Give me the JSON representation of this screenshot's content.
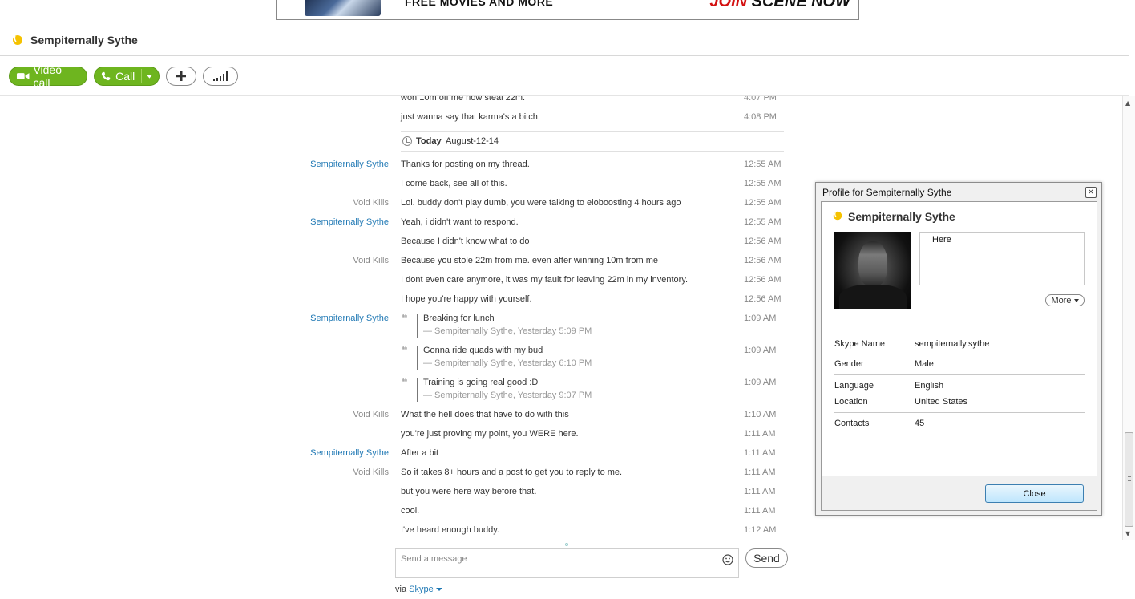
{
  "ad": {
    "left_text": "FREE MOVIES AND MORE",
    "right_join": "JOIN",
    "right_rest": " SCENE NOW"
  },
  "header": {
    "contact_name": "Sempiternally Sythe",
    "status_icon": "skype-status-away-icon",
    "status_color": "#f5c200"
  },
  "toolbar": {
    "video_call_label": "Video call",
    "call_label": "Call",
    "accent": "#6eb51f"
  },
  "chat": {
    "previous": [
      {
        "text": "won 10m off me now steal 22m.",
        "time": "4:07 PM"
      },
      {
        "text": "just wanna say that karma's a bitch.",
        "time": "4:08 PM"
      }
    ],
    "day_separator": {
      "label": "Today",
      "date": "August-12-14"
    },
    "messages": [
      {
        "sender": "Sempiternally Sythe",
        "text": "Thanks for posting on my thread.",
        "time": "12:55 AM"
      },
      {
        "sender": "",
        "text": "I come back, see all of this.",
        "time": "12:55 AM"
      },
      {
        "sender": "Void Kills",
        "text": "Lol. buddy don't play dumb, you were talking to eloboosting 4 hours ago",
        "time": "12:55 AM"
      },
      {
        "sender": "Sempiternally Sythe",
        "text": "Yeah, i didn't want to respond.",
        "time": "12:55 AM"
      },
      {
        "sender": "",
        "text": "Because I didn't know what to do",
        "time": "12:56 AM"
      },
      {
        "sender": "Void Kills",
        "text": "Because you stole 22m from me. even after winning 10m from me",
        "time": "12:56 AM"
      },
      {
        "sender": "",
        "text": "I dont even care anymore, it was my fault for leaving 22m in my inventory.",
        "time": "12:56 AM"
      },
      {
        "sender": "",
        "text": "I hope you're happy with yourself.",
        "time": "12:56 AM"
      }
    ],
    "quotes_sender": "Sempiternally Sythe",
    "quotes": [
      {
        "text": "Breaking for lunch",
        "attribution": "— Sempiternally Sythe, Yesterday 5:09 PM",
        "time": "1:09 AM"
      },
      {
        "text": "Gonna ride quads with my bud",
        "attribution": "— Sempiternally Sythe, Yesterday 6:10 PM",
        "time": "1:09 AM"
      },
      {
        "text": "Training is going real good :D",
        "attribution": "— Sempiternally Sythe, Yesterday 9:07 PM",
        "time": "1:09 AM"
      }
    ],
    "after_quotes": [
      {
        "sender": "Void Kills",
        "text": "What the hell does that have to do with this",
        "time": "1:10 AM"
      },
      {
        "sender": "",
        "text": "you're just proving my point, you WERE here.",
        "time": "1:11 AM"
      },
      {
        "sender": "Sempiternally Sythe",
        "text": "After a bit",
        "time": "1:11 AM"
      },
      {
        "sender": "Void Kills",
        "text": "So it takes 8+ hours and a post to get you to reply to me.",
        "time": "1:11 AM"
      },
      {
        "sender": "",
        "text": "but you were here way before that.",
        "time": "1:11 AM"
      },
      {
        "sender": "",
        "text": "cool.",
        "time": "1:11 AM"
      },
      {
        "sender": "",
        "text": "I've heard enough buddy.",
        "time": "1:12 AM"
      }
    ]
  },
  "compose": {
    "placeholder": "Send a message",
    "send_label": "Send",
    "via_label": "via",
    "via_link": "Skype"
  },
  "profile_dialog": {
    "title": "Profile for Sempiternally Sythe",
    "name": "Sempiternally Sythe",
    "mood": "Here",
    "more_label": "More",
    "fields": {
      "skype_name_label": "Skype Name",
      "skype_name": "sempiternally.sythe",
      "gender_label": "Gender",
      "gender": "Male",
      "language_label": "Language",
      "language": "English",
      "location_label": "Location",
      "location": "United States",
      "contacts_label": "Contacts",
      "contacts": "45"
    },
    "close_label": "Close",
    "close_x": "×"
  }
}
